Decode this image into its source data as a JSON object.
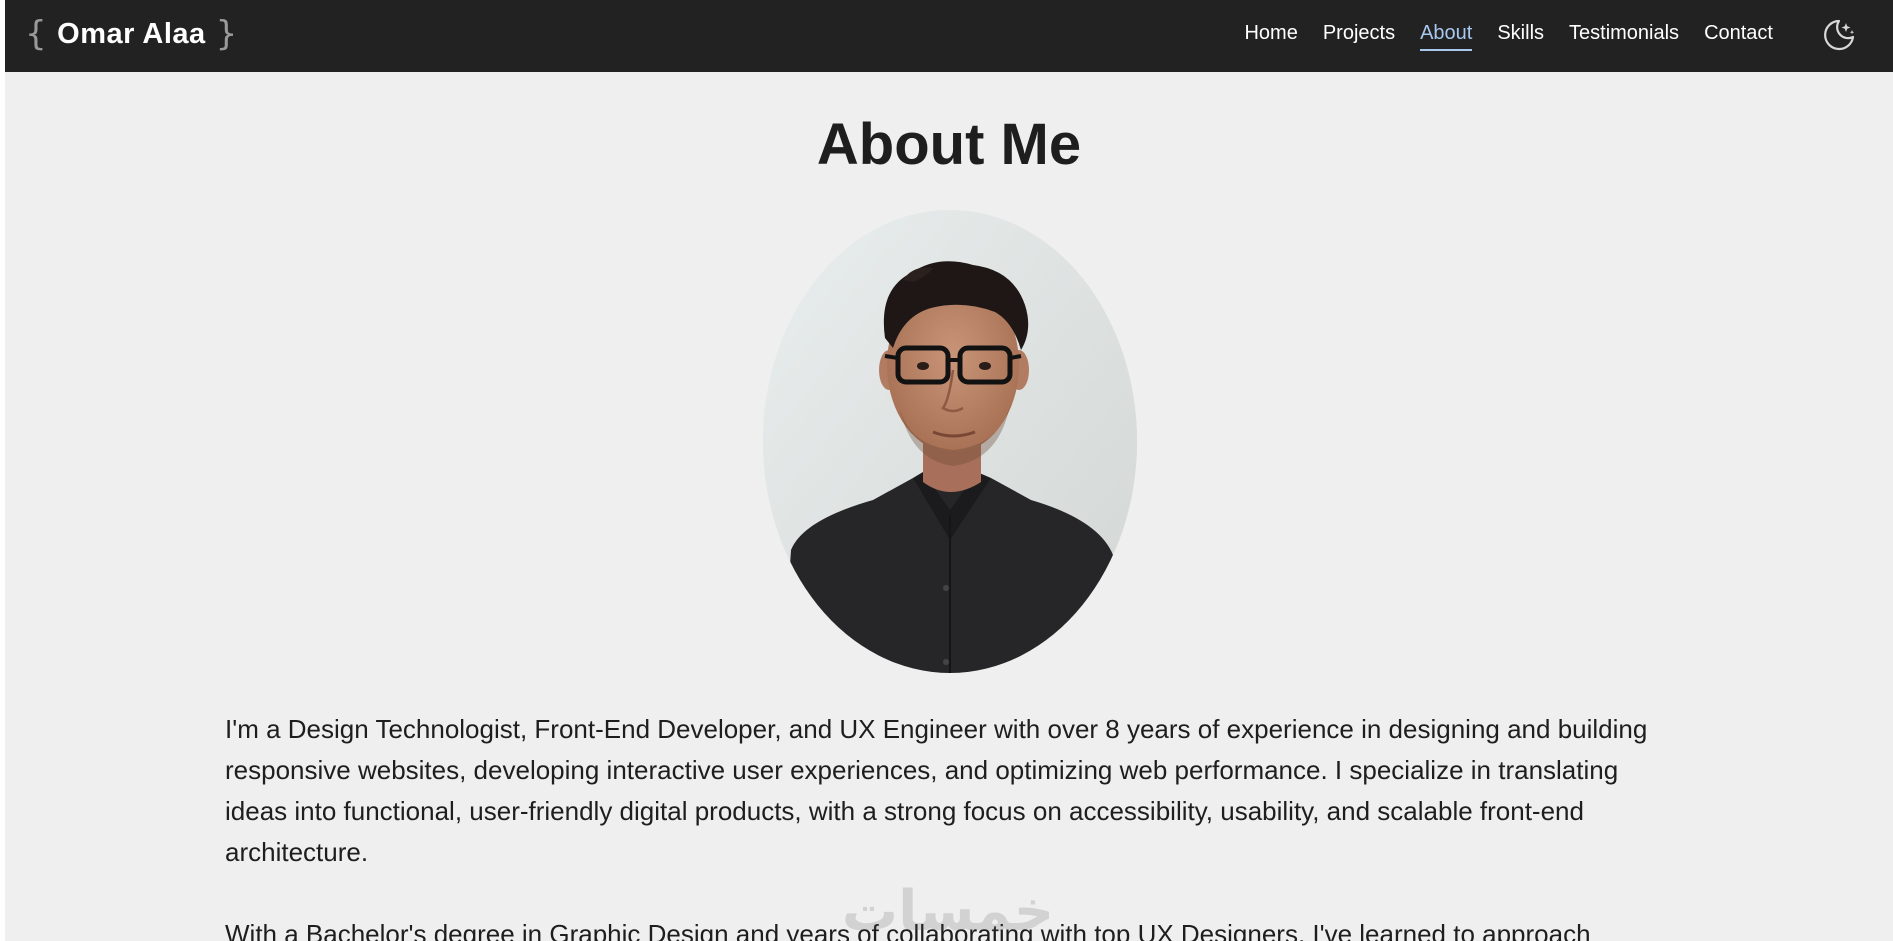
{
  "header": {
    "brand_open": "{",
    "brand_name": "Omar Alaa",
    "brand_close": "}",
    "nav": [
      {
        "label": "Home",
        "active": false
      },
      {
        "label": "Projects",
        "active": false
      },
      {
        "label": "About",
        "active": true
      },
      {
        "label": "Skills",
        "active": false
      },
      {
        "label": "Testimonials",
        "active": false
      },
      {
        "label": "Contact",
        "active": false
      }
    ],
    "theme_toggle_icon": "moon-stars-icon"
  },
  "about": {
    "title": "About Me",
    "paragraphs": [
      "I'm a Design Technologist, Front-End Developer, and UX Engineer with over 8 years of experience in designing and building responsive websites, developing interactive user experiences, and optimizing web performance. I specialize in translating ideas into functional, user-friendly digital products, with a strong focus on accessibility, usability, and scalable front-end architecture.",
      "With a Bachelor's degree in Graphic Design and years of collaborating with top UX Designers, I've learned to approach"
    ]
  },
  "watermark_text": "خمسات",
  "colors": {
    "header_bg": "#222222",
    "page_bg": "#efefef",
    "active_nav": "#a8c8f0",
    "text": "#1e1e1e"
  }
}
